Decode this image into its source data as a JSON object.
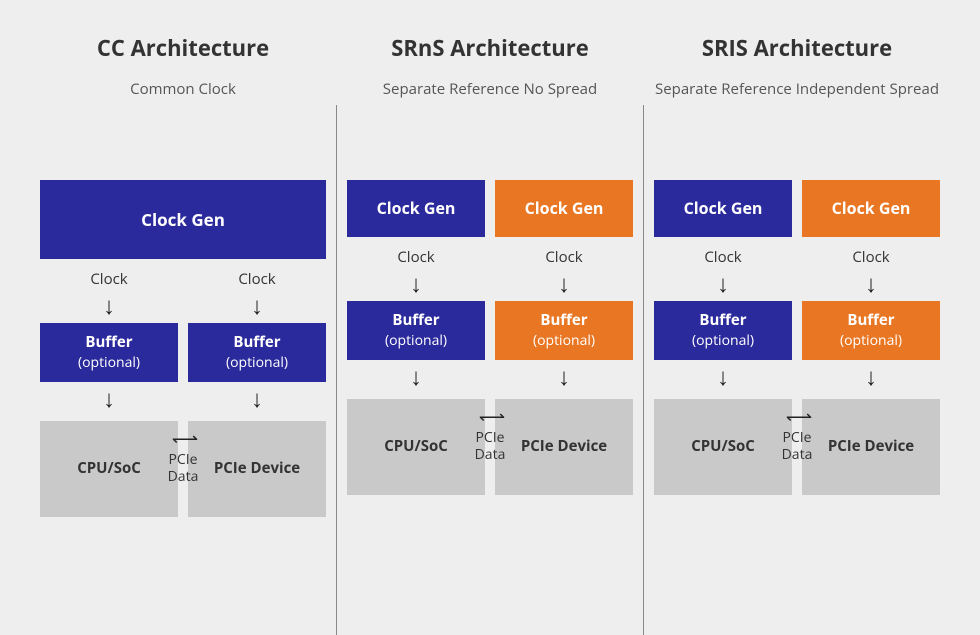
{
  "columns": [
    {
      "title": "CC Architecture",
      "subtitle": "Common Clock",
      "mode": "single",
      "gen_single": "Clock Gen",
      "gen_left_color": "blue",
      "gen_right_color": "blue"
    },
    {
      "title": "SRnS Architecture",
      "subtitle": "Separate Reference No Spread",
      "mode": "dual",
      "gen_left": "Clock Gen",
      "gen_right": "Clock Gen",
      "gen_left_color": "blue",
      "gen_right_color": "orange"
    },
    {
      "title": "SRIS Architecture",
      "subtitle": "Separate Reference Independent Spread",
      "mode": "dual",
      "gen_left": "Clock Gen",
      "gen_right": "Clock Gen",
      "gen_left_color": "blue",
      "gen_right_color": "orange"
    }
  ],
  "labels": {
    "clock": "Clock",
    "buffer": "Buffer",
    "optional": "(optional)",
    "cpu": "CPU/SoC",
    "pcie_device": "PCIe Device",
    "pcie_data": "PCIe Data"
  }
}
